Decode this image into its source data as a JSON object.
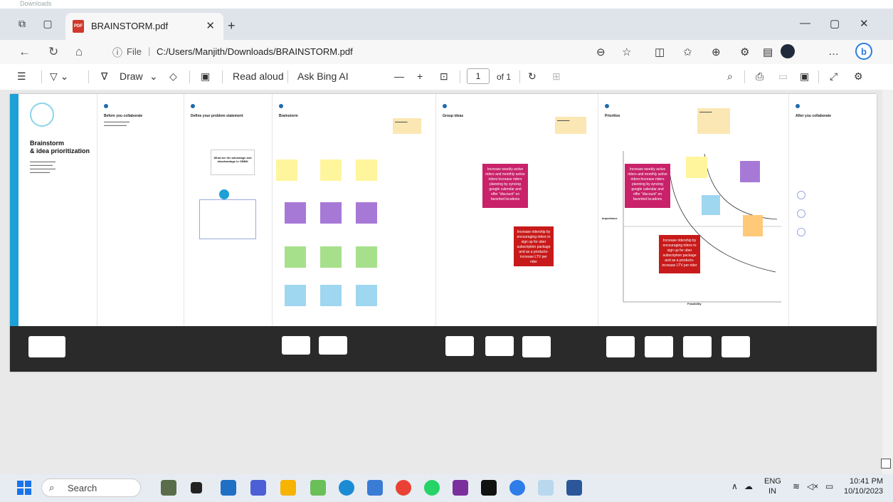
{
  "topstrip": {
    "ghost": "Downloads"
  },
  "tab": {
    "title": "BRAINSTORM.pdf",
    "icon_text": "PDF"
  },
  "address": {
    "scheme_label": "File",
    "path": "C:/Users/Manjith/Downloads/BRAINSTORM.pdf"
  },
  "pdf_toolbar": {
    "draw_label": "Draw",
    "read_aloud_label": "Read aloud",
    "ask_bing_label": "Ask Bing AI",
    "page_current": "1",
    "page_total": "of 1"
  },
  "doc": {
    "cover": {
      "title_line1": "Brainstorm",
      "title_line2": "& idea prioritization"
    },
    "sections": [
      "Before you collaborate",
      "Define your problem statement",
      "Brainstorm",
      "Group ideas",
      "Prioritize",
      "After you collaborate"
    ],
    "problem_prompt": "What are the advantage and disadvantage in OBBN",
    "grouped_idea_1": "Increase weekly active riders and monthly active riders:Increase riders planning by syncing google calendar and offer “discount” on favorited locations",
    "grouped_idea_2": "Increase ridership by encouraging riders to sign up for uber subscription package and as a products-increase LTV per rider",
    "axis_x": "Feasibility",
    "axis_y": "Importance"
  },
  "taskbar": {
    "search_label": "Search",
    "lang_top": "ENG",
    "lang_bottom": "IN",
    "time": "10:41 PM",
    "date": "10/10/2023"
  }
}
